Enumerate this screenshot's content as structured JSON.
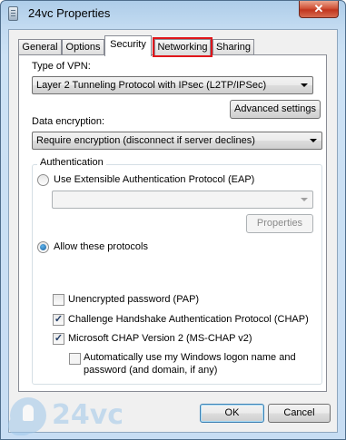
{
  "window": {
    "title": "24vc Properties",
    "close_glyph": "✕",
    "app_icon": "document-icon"
  },
  "tabs": [
    {
      "label": "General"
    },
    {
      "label": "Options"
    },
    {
      "label": "Security"
    },
    {
      "label": "Networking"
    },
    {
      "label": "Sharing"
    }
  ],
  "security": {
    "vpn_type_label": "Type of VPN:",
    "vpn_type_value": "Layer 2 Tunneling Protocol with IPsec (L2TP/IPSec)",
    "advanced_settings_button": "Advanced settings",
    "data_encryption_label": "Data encryption:",
    "data_encryption_value": "Require encryption (disconnect if server declines)",
    "authentication_group_label": "Authentication",
    "eap_radio_label": "Use Extensible Authentication Protocol (EAP)",
    "eap_combo_value": "",
    "properties_button": "Properties",
    "allow_protocols_label": "Allow these protocols",
    "protocols": [
      {
        "label": "Unencrypted password (PAP)",
        "checked": false,
        "mark": ""
      },
      {
        "label": "Challenge Handshake Authentication Protocol (CHAP)",
        "checked": true,
        "mark": "✓"
      },
      {
        "label": "Microsoft CHAP Version 2 (MS-CHAP v2)",
        "checked": true,
        "mark": "✓"
      }
    ],
    "auto_logon_line1": "Automatically use my Windows logon name and",
    "auto_logon_line2": "password (and domain, if any)"
  },
  "footer": {
    "ok_button": "OK",
    "cancel_button": "Cancel"
  },
  "watermark": {
    "text": "24vc"
  },
  "colors": {
    "highlight_box": "#e0161b",
    "close_button": "#c1361f",
    "window_frame": "#c3dbf1"
  }
}
